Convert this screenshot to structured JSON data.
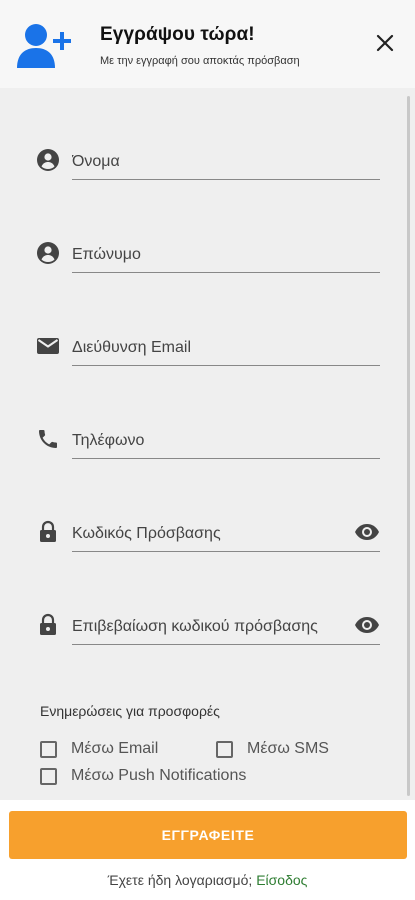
{
  "header": {
    "title": "Εγγράψου τώρα!",
    "subtitle": "Με την εγγραφή σου αποκτάς πρόσβαση",
    "icon": "add-user-icon",
    "close_icon": "close-icon",
    "accent": "#1a73e8"
  },
  "form": {
    "fields": [
      {
        "name": "first-name",
        "icon": "account-circle-icon",
        "placeholder": "Όνομα",
        "value": ""
      },
      {
        "name": "last-name",
        "icon": "account-circle-icon",
        "placeholder": "Επώνυμο",
        "value": ""
      },
      {
        "name": "email",
        "icon": "mail-icon",
        "placeholder": "Διεύθυνση Email",
        "value": ""
      },
      {
        "name": "phone",
        "icon": "phone-icon",
        "placeholder": "Τηλέφωνο",
        "value": ""
      },
      {
        "name": "password",
        "icon": "lock-icon",
        "placeholder": "Κωδικός Πρόσβασης",
        "value": "",
        "trailing_icon": "eye-icon"
      },
      {
        "name": "password-confirm",
        "icon": "lock-icon",
        "placeholder": "Επιβεβαίωση κωδικού πρόσβασης",
        "value": "",
        "trailing_icon": "eye-icon"
      }
    ],
    "offers": {
      "label": "Ενημερώσεις για προσφορές",
      "options": [
        {
          "label": "Μέσω Email",
          "checked": false
        },
        {
          "label": "Μέσω SMS",
          "checked": false
        },
        {
          "label": "Μέσω Push Notifications",
          "checked": false
        }
      ]
    }
  },
  "footer": {
    "submit_label": "ΕΓΓΡΑΦΕΙΤΕ",
    "submit_color": "#f7a02d",
    "login_prompt": "Έχετε ήδη λογαριασμό;",
    "login_link": "Είσοδος",
    "login_link_color": "#2e7d32"
  }
}
